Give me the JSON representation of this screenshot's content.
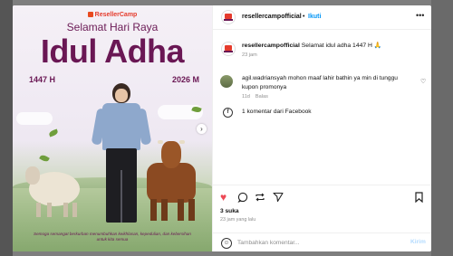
{
  "poster": {
    "brand": "ResellerCamp",
    "greeting": "Selamat Hari Raya",
    "headline": "Idul Adha",
    "year_hijri": "1447 H",
    "year_masehi": "2026 M",
    "caption": "Semoga semangat berkurban menumbuhkan keikhlasan, kepedulian, dan kebersihan untuk kita semua",
    "next_icon": "chevron-right-icon"
  },
  "header": {
    "username": "resellercampofficial",
    "separator": "•",
    "follow_label": "Ikuti",
    "more_icon": "more-icon"
  },
  "post_caption": {
    "username": "resellercampofficial",
    "text": "Selamat idul adha 1447 H 🙏",
    "time": "23 jam"
  },
  "comment": {
    "text": "agil.wadriansyah mohon maaf lahir bathin ya min di tunggu kupon promonya",
    "time": "11d",
    "reply_label": "Balas"
  },
  "facebook": {
    "text": "1 komentar dari Facebook"
  },
  "actions": {
    "like_color": "#ed4956"
  },
  "likes": "3 suka",
  "post_time": "23 jam yang lalu",
  "composer": {
    "placeholder": "Tambahkan komentar...",
    "post_label": "Kirim"
  }
}
